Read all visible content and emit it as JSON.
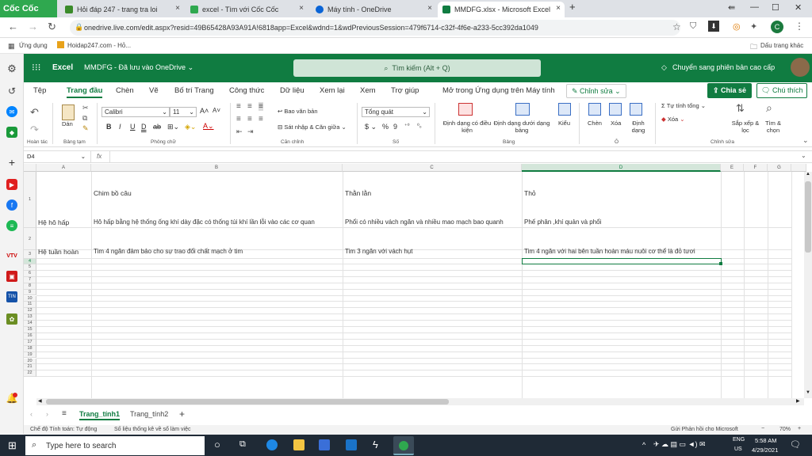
{
  "browser": {
    "brand": "Cốc Cốc",
    "tabs": [
      {
        "label": "Hỏi đáp 247 - trang tra loi",
        "color": "#3b8b2a"
      },
      {
        "label": "excel - Tìm với Cốc Cốc",
        "color": "#2fa84f"
      },
      {
        "label": "Máy tính - OneDrive",
        "color": "#0a64d6"
      },
      {
        "label": "MMDFG.xlsx - Microsoft Excel",
        "color": "#107c41"
      }
    ],
    "url": "onedrive.live.com/edit.aspx?resid=49B65428A93A91A!6818app=Excel&wdnd=1&wdPreviousSession=479f6714-c32f-4f6e-a233-5cc392da1049",
    "bookmarks": [
      "Ứng dụng",
      "Hoidap247.com - Hỏ..."
    ],
    "other_bookmarks": "Dấu trang khác",
    "profile_initial": "C"
  },
  "excel": {
    "app": "Excel",
    "doc_name": "MMDFG",
    "saved_status": "Đã lưu vào OneDrive",
    "search_placeholder": "Tìm kiếm (Alt + Q)",
    "premium_label": "Chuyển sang phiên bản cao cấp",
    "menu_tabs": [
      "Tệp",
      "Trang đầu",
      "Chèn",
      "Vẽ",
      "Bố trí Trang",
      "Công thức",
      "Dữ liệu",
      "Xem lại",
      "Xem",
      "Trợ giúp",
      "Mở trong Ứng dụng trên Máy tính"
    ],
    "edit_mode": "Chỉnh sửa",
    "share_label": "Chia sẻ",
    "comment_label": "Chú thích",
    "ribbon": {
      "groups": [
        "Hoàn tác",
        "Bảng tạm",
        "Phông chữ",
        "Căn chỉnh",
        "Số",
        "Bảng",
        "Ô",
        "Chỉnh sửa"
      ],
      "paste": "Dán",
      "font": "Calibri",
      "font_size": "11",
      "wrap_text": "Bao văn bản",
      "merge": "Sát nhập & Căn giữa",
      "number_format": "Tổng quát",
      "conditional": "Định dạng có điều kiện",
      "format_table": "Định dạng dưới dạng bảng",
      "styles": "Kiểu",
      "insert": "Chèn",
      "delete": "Xóa",
      "format": "Định dạng",
      "autosum": "Tự tính tổng",
      "clear": "Xóa",
      "sort_filter": "Sắp xếp & lọc",
      "find": "Tìm & chọn"
    },
    "name_box": "D4",
    "fx": "fx",
    "columns": [
      "A",
      "B",
      "C",
      "D",
      "E",
      "F",
      "G"
    ],
    "rows": [
      "1",
      "2",
      "3",
      "4",
      "5",
      "6",
      "7",
      "8",
      "9",
      "10",
      "11",
      "12",
      "13",
      "14",
      "15",
      "16",
      "17",
      "18",
      "19",
      "20",
      "21",
      "22"
    ],
    "cells": {
      "B1": "Chim bồ câu",
      "C1": "Thằn lằn",
      "D1": "Thỏ",
      "A2": "Hệ hô hấp",
      "B2": "Hô hấp bằng hệ thống ống khí dày đặc có thống túi khí lần lỗi vào các cơ quan",
      "C2": "Phổi có nhiều vách ngăn và nhiều mao mạch bao quanh",
      "D2": "Phế phân ,khí quản và phổi",
      "A3": "Hệ tuần hoàn",
      "B3": "Tim 4 ngăn đảm bảo cho sự trao đổi chất mạch ở tim",
      "C3": "Tim 3 ngăn với vách hụt",
      "D3": "Tim 4 ngăn với hai bên tuần hoàn máu nuôi cơ thể là đỏ tươi"
    },
    "sheets": [
      "Trang_tính1",
      "Trang_tính2"
    ],
    "status_left": [
      "Chế độ Tính toán: Tự động",
      "Số liệu thống kê về sổ làm việc"
    ],
    "feedback": "Gửi Phản hồi cho Microsoft",
    "zoom": "70%"
  },
  "taskbar": {
    "search_placeholder": "Type here to search",
    "lang": "ENG",
    "region": "US",
    "time": "5:58 AM",
    "date": "4/29/2021"
  }
}
